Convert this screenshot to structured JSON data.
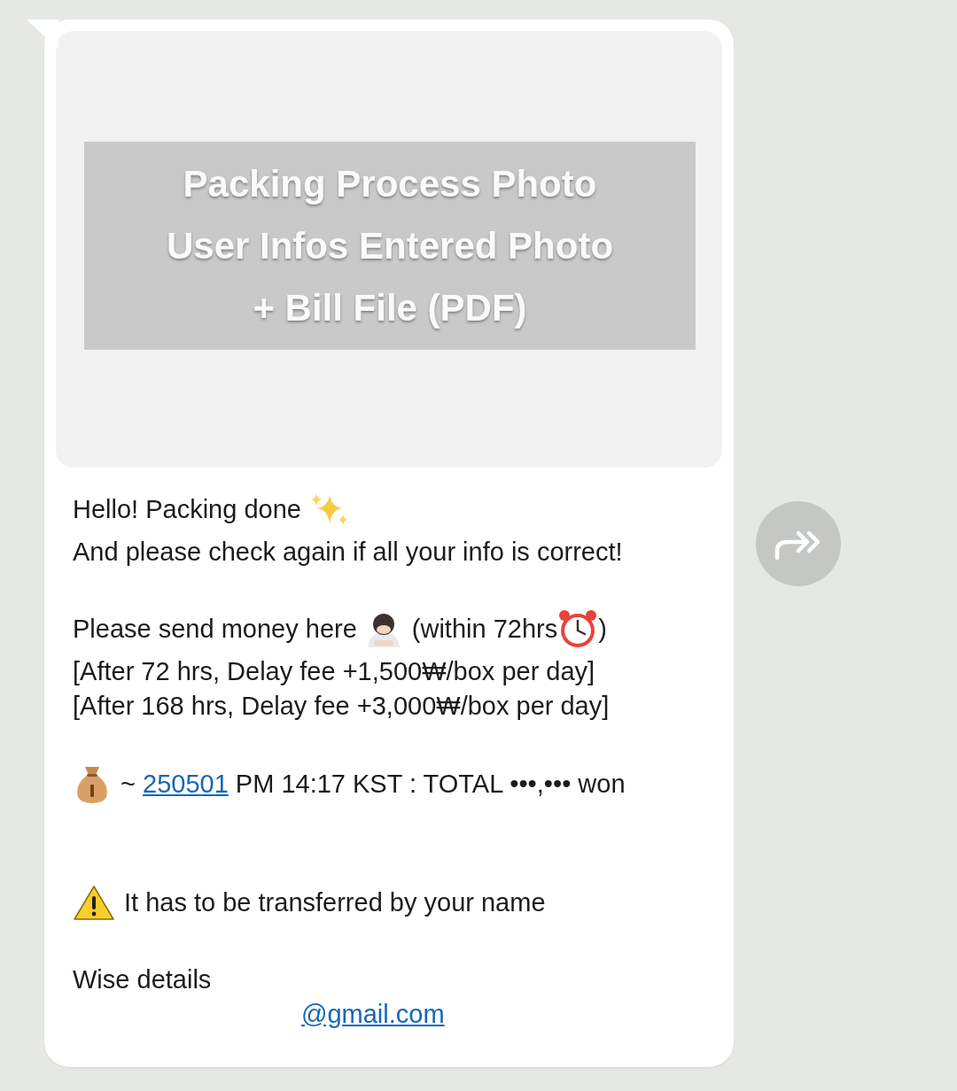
{
  "message": {
    "image": {
      "lines": [
        "Packing Process Photo",
        "User Infos Entered Photo",
        "+ Bill File (PDF)"
      ]
    },
    "greeting": "Hello! Packing done",
    "check_note": "And please check again if all your info is correct!",
    "payment": {
      "prefix": "Please send money here",
      "within": "(within 72hrs",
      "close": ")"
    },
    "fees": [
      "[After 72 hrs, Delay fee +1,500₩/box per day]",
      "[After 168 hrs, Delay fee +3,000₩/box per day]"
    ],
    "deadline": {
      "tilde": "~",
      "date": "250501",
      "rest": "PM 14:17 KST : TOTAL •••,••• won"
    },
    "warning": "It has to be transferred by your name",
    "wise_label": "Wise details",
    "email": "@gmail.com"
  },
  "forward_button": {
    "kind": "forward"
  }
}
